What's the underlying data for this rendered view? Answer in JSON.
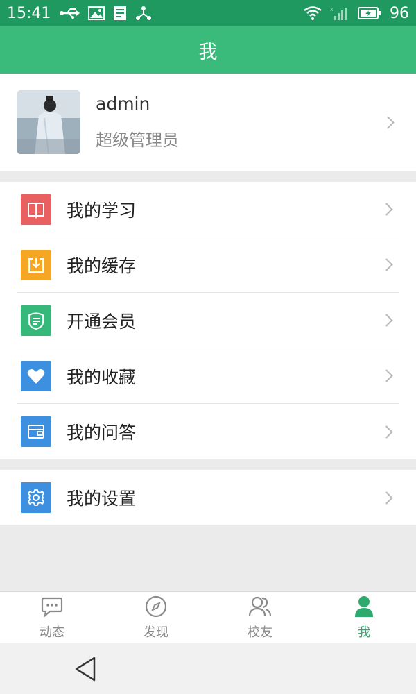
{
  "status_bar": {
    "time": "15:41",
    "icons_left": [
      "usb-icon",
      "image-icon",
      "document-icon",
      "share-icon"
    ],
    "icons_right": [
      "wifi-icon",
      "signal-icon",
      "battery-icon"
    ],
    "battery_level": "96"
  },
  "header": {
    "title": "我"
  },
  "profile": {
    "name": "admin",
    "role": "超级管理员"
  },
  "menu": [
    {
      "label": "我的学习",
      "icon": "book-icon",
      "color": "#e8605f"
    },
    {
      "label": "我的缓存",
      "icon": "download-icon",
      "color": "#f5a623"
    },
    {
      "label": "开通会员",
      "icon": "member-badge-icon",
      "color": "#36b87a"
    },
    {
      "label": "我的收藏",
      "icon": "heart-icon",
      "color": "#3d8fe0"
    },
    {
      "label": "我的问答",
      "icon": "qa-card-icon",
      "color": "#3d8fe0"
    }
  ],
  "settings": {
    "label": "我的设置",
    "icon": "gear-icon",
    "color": "#3d8fe0"
  },
  "tabs": [
    {
      "label": "动态",
      "icon": "chat-bubble-icon",
      "active": false
    },
    {
      "label": "发现",
      "icon": "compass-icon",
      "active": false
    },
    {
      "label": "校友",
      "icon": "people-icon",
      "active": false
    },
    {
      "label": "我",
      "icon": "person-icon",
      "active": true
    }
  ],
  "colors": {
    "status_bar": "#1f9960",
    "header": "#3abb7c",
    "active_tab": "#2eaa6e",
    "inactive_tab": "#8a8a8a"
  }
}
